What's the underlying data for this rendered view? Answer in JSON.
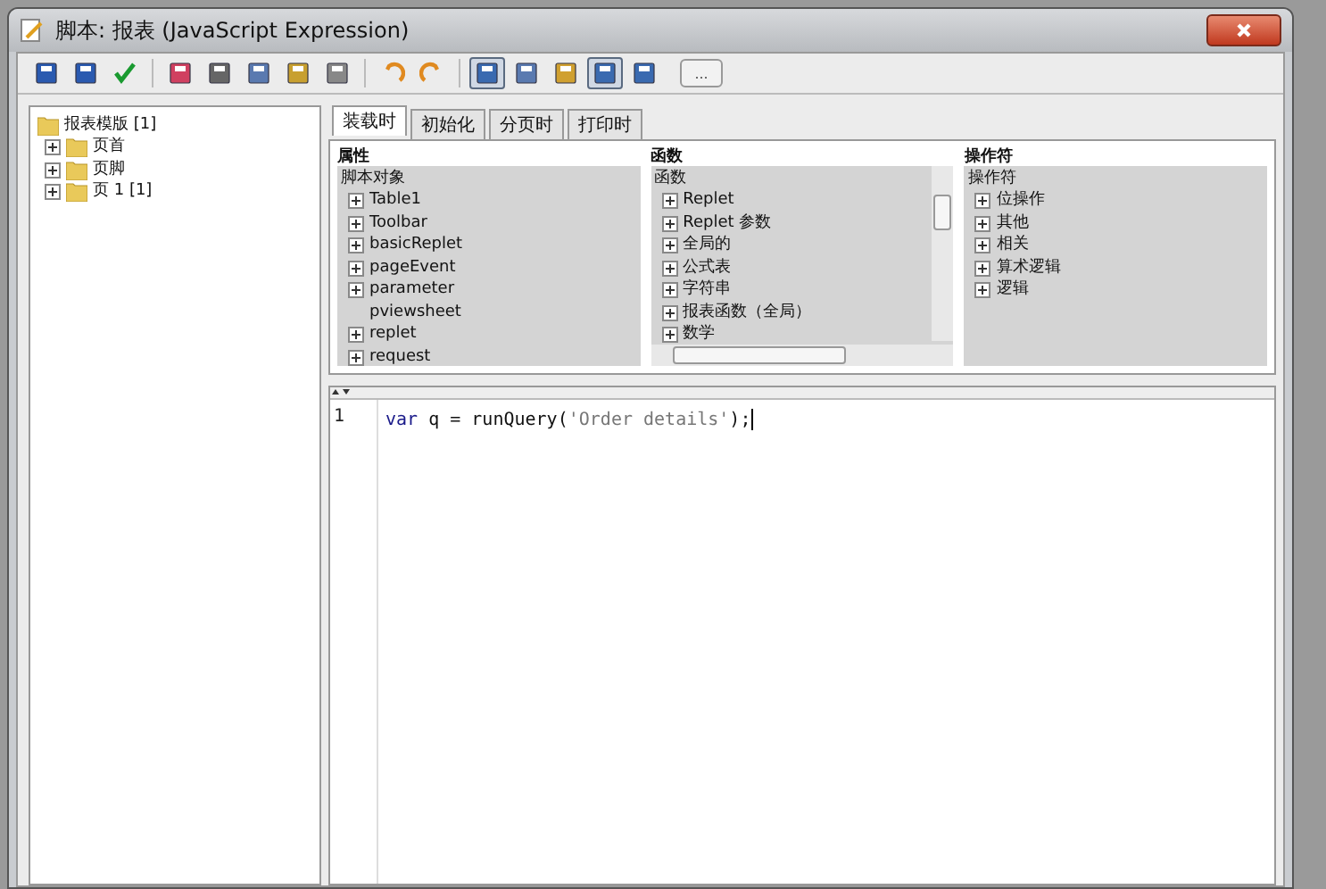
{
  "window": {
    "title": "脚本: 报表 (JavaScript Expression)"
  },
  "toolbar": [
    {
      "selected": false
    },
    {
      "selected": false
    },
    {
      "selected": false
    },
    {
      "selected": false
    },
    {
      "selected": false
    },
    {
      "selected": false
    },
    {
      "selected": false
    },
    {
      "selected": false
    },
    {
      "selected": false
    },
    {
      "selected": false
    },
    {
      "selected": true
    },
    {
      "selected": false
    },
    {
      "selected": false
    },
    {
      "selected": true
    },
    {
      "selected": false
    }
  ],
  "more_button": "...",
  "tree": {
    "label": "报表模版 [1]",
    "children": [
      {
        "label": "页首"
      },
      {
        "label": "页脚"
      },
      {
        "label": "页 1 [1]"
      }
    ]
  },
  "tabs": [
    {
      "label": "装载时",
      "selected": true
    },
    {
      "label": "初始化",
      "selected": false
    },
    {
      "label": "分页时",
      "selected": false
    },
    {
      "label": "打印时",
      "selected": false
    }
  ],
  "panels": [
    {
      "title": "属性",
      "root": "脚本对象",
      "items": [
        {
          "label": "Table1",
          "expandable": true
        },
        {
          "label": "Toolbar",
          "expandable": true
        },
        {
          "label": "basicReplet",
          "expandable": true
        },
        {
          "label": "pageEvent",
          "expandable": true
        },
        {
          "label": "parameter",
          "expandable": true
        },
        {
          "label": "pviewsheet",
          "expandable": false
        },
        {
          "label": "replet",
          "expandable": true
        },
        {
          "label": "request",
          "expandable": true
        }
      ]
    },
    {
      "title": "函数",
      "root": "函数",
      "scrollbars": true,
      "items": [
        {
          "label": "Replet",
          "expandable": true
        },
        {
          "label": "Replet 参数",
          "expandable": true
        },
        {
          "label": "全局的",
          "expandable": true
        },
        {
          "label": "公式表",
          "expandable": true
        },
        {
          "label": "字符串",
          "expandable": true
        },
        {
          "label": "报表函数（全局）",
          "expandable": true
        },
        {
          "label": "数学",
          "expandable": true
        }
      ]
    },
    {
      "title": "操作符",
      "root": "操作符",
      "items": [
        {
          "label": "位操作",
          "expandable": true
        },
        {
          "label": "其他",
          "expandable": true
        },
        {
          "label": "相关",
          "expandable": true
        },
        {
          "label": "算术逻辑",
          "expandable": true
        },
        {
          "label": "逻辑",
          "expandable": true
        }
      ]
    }
  ],
  "editor": {
    "lines": [
      {
        "number": "1",
        "tokens": [
          {
            "kind": "keyword",
            "text": "var"
          },
          {
            "kind": "plain",
            "text": " q = runQuery("
          },
          {
            "kind": "string",
            "text": "'Order details'"
          },
          {
            "kind": "plain",
            "text": ");"
          }
        ]
      }
    ]
  }
}
